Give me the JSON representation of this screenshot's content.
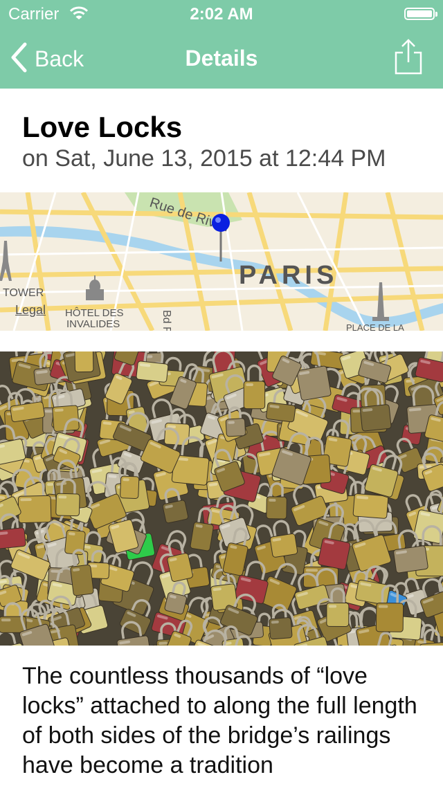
{
  "status_bar": {
    "carrier": "Carrier",
    "time": "2:02 AM",
    "wifi_icon": "wifi-icon",
    "battery_icon": "battery-icon"
  },
  "nav": {
    "back_label": "Back",
    "title": "Details",
    "share_icon": "share-icon",
    "background": "#7ecba8"
  },
  "entry": {
    "title": "Love Locks",
    "datetime": "on Sat, June 13, 2015 at 12:44 PM",
    "description": "The countless thousands of “love locks” attached to along the full length of both sides of the bridge’s railings have become a tradition"
  },
  "map": {
    "labels": {
      "street": "Rue de Rivoli",
      "city": "PARIS",
      "tower": "TOWER",
      "invalides_1": "HÔTEL DES",
      "invalides_2": "INVALIDES",
      "boulevard": "Bd R",
      "place": "PLACE DE LA"
    },
    "legal": "Legal",
    "pin_color": "#0a1fe0"
  }
}
